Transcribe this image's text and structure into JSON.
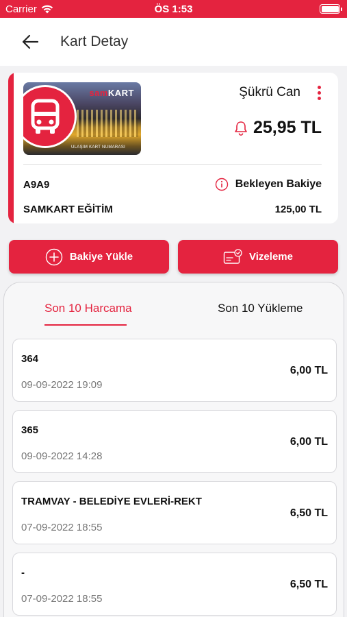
{
  "status_bar": {
    "carrier": "Carrier",
    "time": "ÖS 1:53"
  },
  "header": {
    "title": "Kart Detay"
  },
  "card": {
    "brand_prefix": "sam",
    "brand_suffix": "KART",
    "image_caption": "ULAŞIM KART NUMARASI",
    "owner": "Şükrü Can",
    "balance": "25,95 TL",
    "card_number": "A9A9",
    "pending_label": "Bekleyen Bakiye",
    "card_type": "SAMKART EĞİTİM",
    "pending_amount": "125,00 TL"
  },
  "actions": {
    "load_balance": "Bakiye Yükle",
    "visa": "Vizeleme"
  },
  "tabs": {
    "spending": "Son 10 Harcama",
    "loading": "Son 10 Yükleme",
    "active": "spending"
  },
  "transactions": [
    {
      "title": "364",
      "date": "09-09-2022 19:09",
      "amount": "6,00 TL"
    },
    {
      "title": "365",
      "date": "09-09-2022 14:28",
      "amount": "6,00 TL"
    },
    {
      "title": "TRAMVAY - BELEDİYE EVLERİ-REKT",
      "date": "07-09-2022 18:55",
      "amount": "6,50 TL"
    },
    {
      "title": "-",
      "date": "07-09-2022 18:55",
      "amount": "6,50 TL"
    }
  ],
  "colors": {
    "accent": "#e4233f",
    "background": "#f2f2f4"
  },
  "icons": {
    "back": "arrow-left-icon",
    "bell": "bell-icon",
    "info": "info-icon",
    "more": "more-vertical-icon",
    "plus": "plus-circle-icon",
    "card": "card-check-icon"
  }
}
